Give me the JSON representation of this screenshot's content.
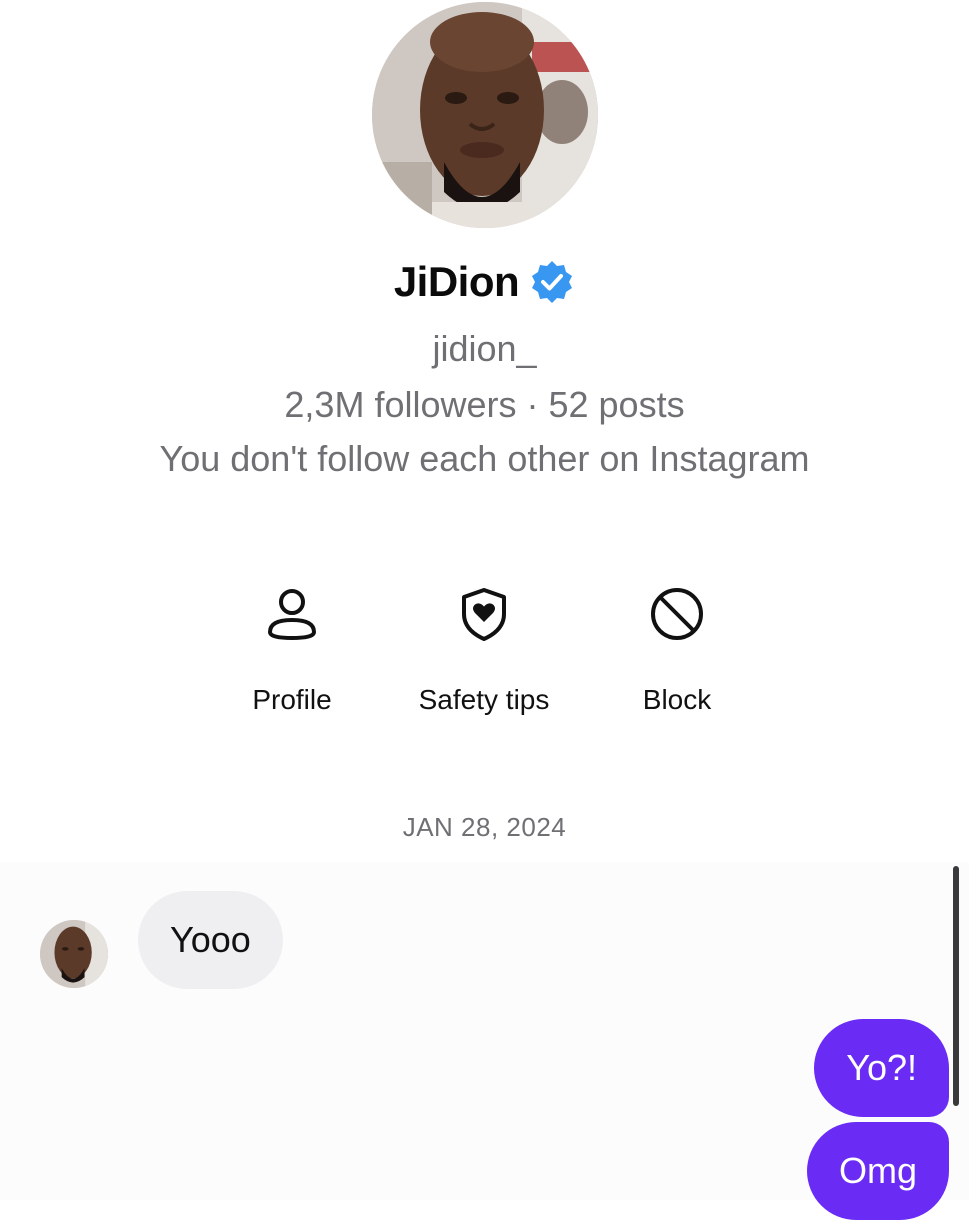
{
  "profile": {
    "display_name": "JiDion",
    "verified": true,
    "username": "jidion_",
    "stats": "2,3M followers · 52 posts",
    "follow_note": "You don't follow each other on Instagram"
  },
  "actions": [
    {
      "label": "Profile",
      "icon": "person-icon"
    },
    {
      "label": "Safety tips",
      "icon": "shield-heart-icon"
    },
    {
      "label": "Block",
      "icon": "block-icon"
    }
  ],
  "thread": {
    "date": "JAN 28, 2024",
    "messages": [
      {
        "from": "them",
        "text": "Yooo"
      },
      {
        "from": "me",
        "text": "Yo?!"
      },
      {
        "from": "me",
        "text": "Omg"
      }
    ]
  },
  "colors": {
    "accent": "#6a2cf5",
    "verified": "#3897f0",
    "incoming_bubble": "#efeff2",
    "secondary_text": "#6f6f74"
  }
}
